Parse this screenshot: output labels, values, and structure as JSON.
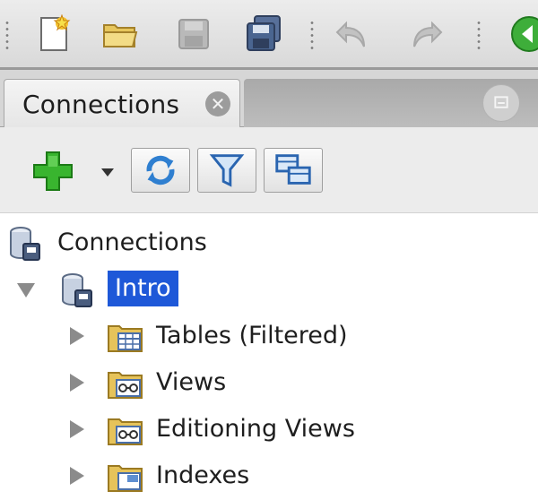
{
  "toolbar": {
    "buttons": [
      {
        "name": "new-icon",
        "enabled": true
      },
      {
        "name": "open-folder-icon",
        "enabled": true
      },
      {
        "name": "save-icon",
        "enabled": false
      },
      {
        "name": "save-all-icon",
        "enabled": true
      },
      {
        "name": "undo-icon",
        "enabled": false
      },
      {
        "name": "redo-icon",
        "enabled": false
      },
      {
        "name": "back-icon",
        "enabled": true
      }
    ]
  },
  "panel": {
    "tab_label": "Connections",
    "close_glyph": "✕",
    "toolbar": [
      "add-connection-icon",
      "refresh-icon",
      "filter-icon",
      "schema-browser-icon"
    ]
  },
  "tree": {
    "root": {
      "label": "Connections",
      "icon": "connections-icon"
    },
    "connection": {
      "label": "Intro",
      "icon": "database-icon",
      "expanded": true,
      "selected": true
    },
    "children": [
      {
        "label": "Tables (Filtered)",
        "icon": "tables-folder-icon"
      },
      {
        "label": "Views",
        "icon": "views-folder-icon"
      },
      {
        "label": "Editioning Views",
        "icon": "editioning-views-folder-icon"
      },
      {
        "label": "Indexes",
        "icon": "indexes-folder-icon"
      }
    ]
  },
  "colors": {
    "selection": "#1e58d8",
    "toolbar_bg": "#e3e3e3",
    "add_green": "#2fa52a",
    "folder_yellow": "#e6c35a"
  }
}
